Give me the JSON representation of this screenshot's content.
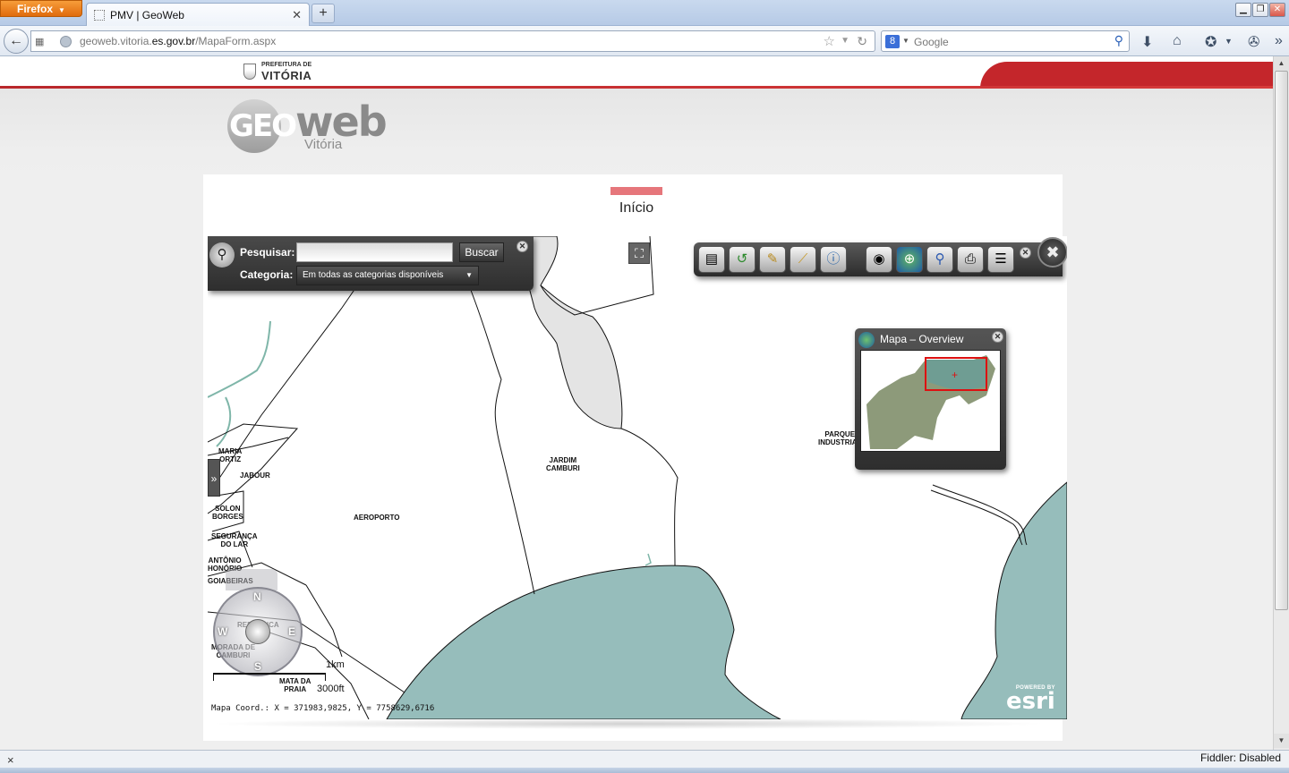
{
  "browser": {
    "menu_label": "Firefox",
    "tab_title": "PMV | GeoWeb",
    "new_tab": "+",
    "url_prefix": "geoweb.vitoria.",
    "url_domain": "es.gov.br",
    "url_path": "/MapaForm.aspx",
    "search_engine_icon": "8",
    "search_placeholder": "Google",
    "status_close": "×",
    "status_text": "Fiddler: Disabled"
  },
  "site": {
    "prefeitura_line1": "PREFEITURA DE",
    "prefeitura_line2": "VITÓRIA",
    "logo_geo": "GEO",
    "logo_web": "web",
    "logo_city": "Vitória",
    "tab_title": "Início"
  },
  "search": {
    "label": "Pesquisar:",
    "input_value": "",
    "button": "Buscar",
    "category_label": "Categoria:",
    "category_value": "Em todas as categorias disponíveis"
  },
  "toolbar": {
    "tools": [
      "layers-icon",
      "refresh-map-icon",
      "clear-graphics-icon",
      "measure-ruler-icon",
      "identify-icon",
      "visibility-eye-icon",
      "basemap-globe-icon",
      "zoom-search-icon",
      "print-icon",
      "legend-list-icon"
    ]
  },
  "overview": {
    "title": "Mapa – Overview"
  },
  "map": {
    "labels": [
      {
        "id": "maria-ortiz",
        "text": "MARIA\nORTIZ"
      },
      {
        "id": "jabour",
        "text": "JABOUR"
      },
      {
        "id": "solon-borges",
        "text": "SOLON\nBORGES"
      },
      {
        "id": "seguranca-do-lar",
        "text": "SEGURANÇA\nDO LAR"
      },
      {
        "id": "antonio-honorio",
        "text": "ANTÔNIO\nHONÓRIO"
      },
      {
        "id": "goiabeiras",
        "text": "GOIABEIRAS"
      },
      {
        "id": "republica",
        "text": "REPÚBLICA"
      },
      {
        "id": "morada-de-camburi",
        "text": "MORADA DE\nCAMBURI"
      },
      {
        "id": "mata-da-praia",
        "text": "MATA DA\nPRAIA"
      },
      {
        "id": "aeroporto",
        "text": "AEROPORTO"
      },
      {
        "id": "jardim-camburi",
        "text": "JARDIM\nCAMBURI"
      },
      {
        "id": "parque-industrial",
        "text": "PARQUE\nINDUSTRIAL"
      }
    ],
    "compass": {
      "n": "N",
      "s": "S",
      "e": "E",
      "w": "W"
    },
    "scale_km": "1km",
    "scale_ft": "3000ft",
    "coords": "Mapa Coord.: X = 371983,9825, Y = 7758629,6716",
    "esri_powered": "POWERED BY",
    "esri_logo": "esri",
    "colors": {
      "water": "#8fb8b6",
      "sea": "#96bdbb",
      "airport": "#e4e4e4"
    }
  }
}
